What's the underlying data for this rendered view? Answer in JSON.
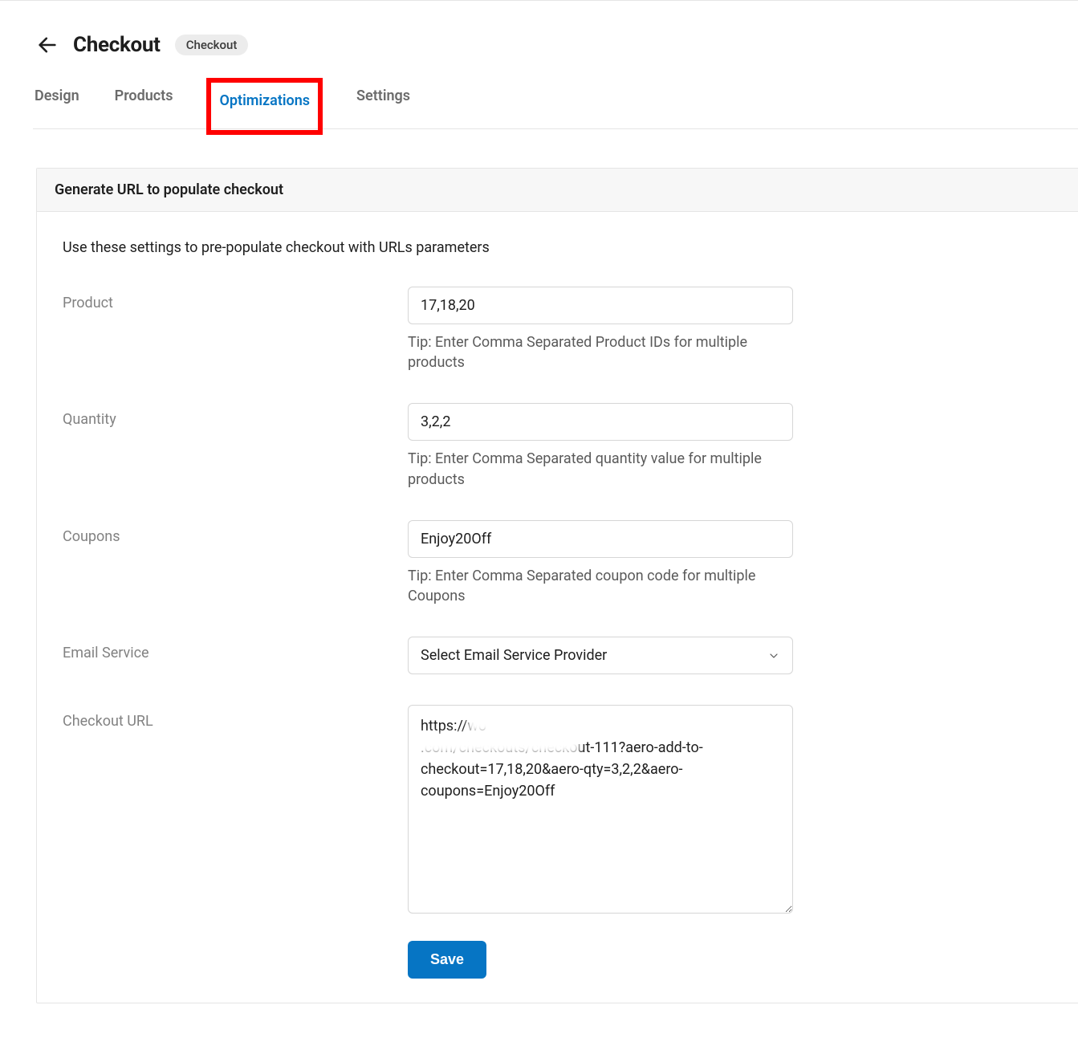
{
  "header": {
    "title": "Checkout",
    "badge": "Checkout"
  },
  "tabs": {
    "items": [
      {
        "label": "Design"
      },
      {
        "label": "Products"
      },
      {
        "label": "Optimizations"
      },
      {
        "label": "Settings"
      }
    ]
  },
  "panel": {
    "title": "Generate URL to populate checkout",
    "description": "Use these settings to pre-populate checkout with URLs parameters"
  },
  "fields": {
    "product": {
      "label": "Product",
      "value": "17,18,20",
      "tip": "Tip: Enter Comma Separated Product IDs for multiple products"
    },
    "quantity": {
      "label": "Quantity",
      "value": "3,2,2",
      "tip": "Tip: Enter Comma Separated quantity value for multiple products"
    },
    "coupons": {
      "label": "Coupons",
      "value": "Enjoy20Off",
      "tip": "Tip: Enter Comma Separated coupon code for multiple Coupons"
    },
    "email_service": {
      "label": "Email Service",
      "selected": "Select Email Service Provider"
    },
    "checkout_url": {
      "label": "Checkout URL",
      "value": "https://wo                                       .com/checkouts/checkout-111?aero-add-to-checkout=17,18,20&aero-qty=3,2,2&aero-coupons=Enjoy20Off"
    }
  },
  "buttons": {
    "save": "Save"
  }
}
